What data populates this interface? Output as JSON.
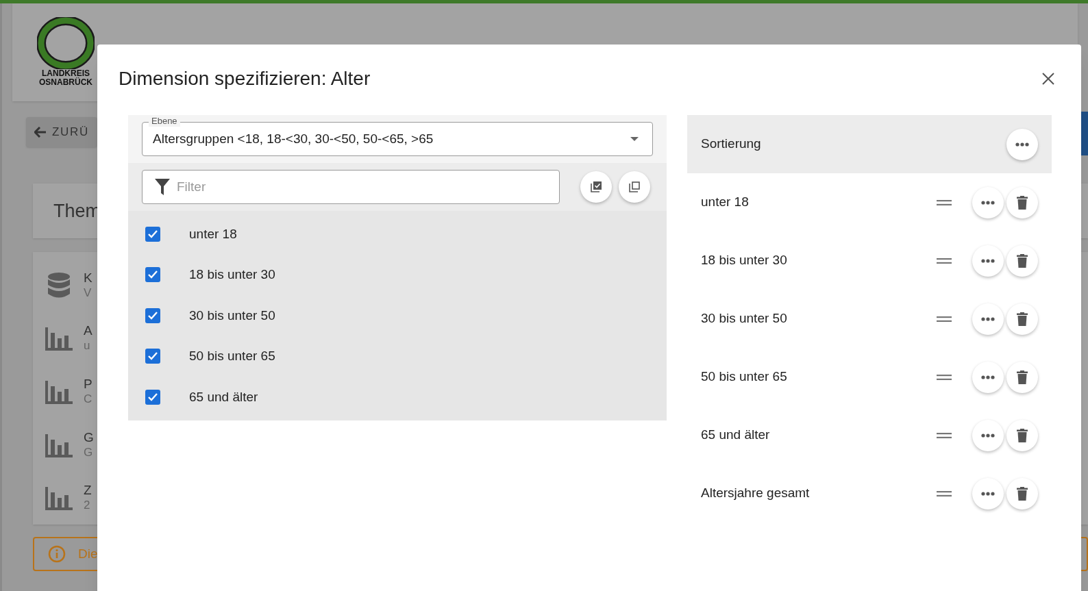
{
  "background": {
    "logo": {
      "line_1": "LANDKREIS",
      "line_2": "OSNABRÜCK"
    },
    "back_button": "ZURÜ",
    "heading": "Them",
    "items": [
      {
        "kind": "database",
        "title": "K",
        "subtitle": "V"
      },
      {
        "kind": "chart",
        "title": "A",
        "subtitle": "u"
      },
      {
        "kind": "chart",
        "title": "P",
        "subtitle": "C"
      },
      {
        "kind": "chart",
        "title": "G",
        "subtitle": "G"
      },
      {
        "kind": "chart",
        "title": "Z",
        "subtitle": "2"
      }
    ],
    "notice": "Die"
  },
  "dialog": {
    "title": "Dimension spezifizieren: Alter",
    "level_select": {
      "label": "Ebene",
      "value": "Altersgruppen <18, 18-<30, 30-<50, 50-<65, >65"
    },
    "filter": {
      "placeholder": "Filter"
    },
    "options": [
      {
        "label": "unter 18",
        "checked": true
      },
      {
        "label": "18 bis unter 30",
        "checked": true
      },
      {
        "label": "30 bis unter 50",
        "checked": true
      },
      {
        "label": "50 bis unter 65",
        "checked": true
      },
      {
        "label": "65 und älter",
        "checked": true
      }
    ],
    "sorting": {
      "title": "Sortierung"
    },
    "sort_items": [
      {
        "label": "unter 18"
      },
      {
        "label": "18 bis unter 30"
      },
      {
        "label": "30 bis unter 50"
      },
      {
        "label": "50 bis unter 65"
      },
      {
        "label": "65 und älter"
      },
      {
        "label": "Altersjahre gesamt"
      }
    ]
  }
}
